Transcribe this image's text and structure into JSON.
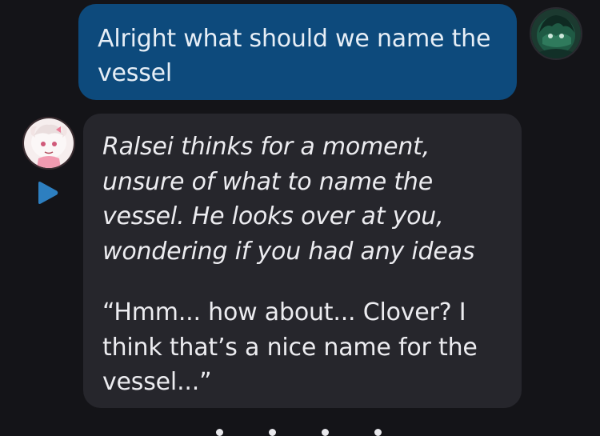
{
  "chat": {
    "user_message": {
      "text": "Alright what should we name the vessel",
      "avatar_icon": "user-avatar-green-character"
    },
    "bot_message": {
      "narration": "Ralsei thinks for a moment, unsure of what to name the vessel. He looks over at you, wondering if you had any ideas",
      "dialogue": "“Hmm... how about... Clover? I think that’s a nice name for the vessel...”",
      "avatar_icon": "bot-avatar-ralsei",
      "play_icon": "play-icon"
    },
    "typing_indicator": {
      "dots": 4
    }
  },
  "colors": {
    "background": "#141418",
    "user_bubble": "#0d4a7c",
    "bot_bubble": "#26262c",
    "play_button": "#2d7fc0"
  }
}
